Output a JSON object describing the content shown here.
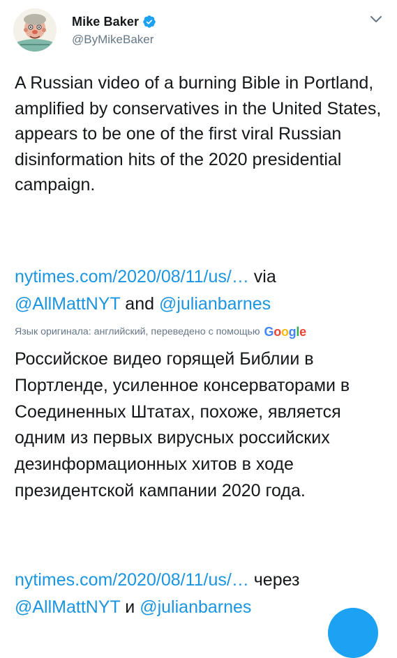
{
  "author": {
    "display_name": "Mike Baker",
    "handle": "@ByMikeBaker",
    "avatar_icon": "cartoon-avatar-icon",
    "verified_icon": "verified-badge-icon"
  },
  "tweet": {
    "text": "A Russian video of a burning Bible in Portland, amplified by conservatives in the United States, appears to be one of the first viral Russian disinformation hits of the 2020 presidential campaign.",
    "link": "nytimes.com/2020/08/11/us/…",
    "via": "via",
    "mention_1": "@AllMattNYT",
    "and": "and",
    "mention_2": "@julianbarnes"
  },
  "translation": {
    "note": "Язык оригинала: английский, переведено с помощью",
    "provider": "Google",
    "text": "Российское видео горящей Библии в Портленде, усиленное консерваторами в Соединенных Штатах, похоже, является одним из первых вирусных российских дезинформационных хитов в ходе президентской кампании 2020 года.",
    "link": "nytimes.com/2020/08/11/us/…",
    "via": "через",
    "mention_1": "@AllMattNYT",
    "and": "и",
    "mention_2": "@julianbarnes"
  },
  "colors": {
    "link": "#1b95e0",
    "secondary_text": "#657786",
    "primary_text": "#14171a",
    "fab": "#1da1f2"
  },
  "icons": {
    "caret": "chevron-down-icon",
    "fab": "compose-button"
  }
}
